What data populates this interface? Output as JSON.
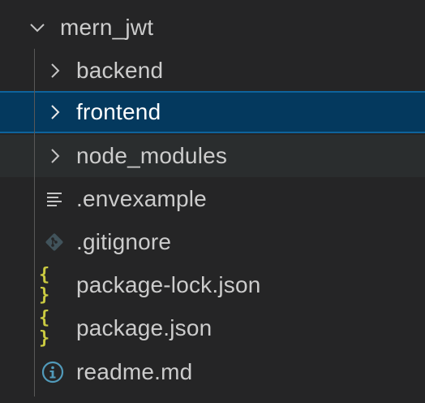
{
  "explorer": {
    "root": {
      "label": "mern_jwt",
      "icon": "chevron-down-icon"
    },
    "items": [
      {
        "label": "backend",
        "type": "folder",
        "icon": "chevron-right-icon"
      },
      {
        "label": "frontend",
        "type": "folder",
        "icon": "chevron-right-icon",
        "selected": true
      },
      {
        "label": "node_modules",
        "type": "folder",
        "icon": "chevron-right-icon",
        "hovered": true
      },
      {
        "label": ".envexample",
        "type": "file",
        "icon": "lines-file-icon"
      },
      {
        "label": ".gitignore",
        "type": "file",
        "icon": "git-icon"
      },
      {
        "label": "package-lock.json",
        "type": "file",
        "icon": "json-braces-icon"
      },
      {
        "label": "package.json",
        "type": "file",
        "icon": "json-braces-icon"
      },
      {
        "label": "readme.md",
        "type": "file",
        "icon": "info-icon"
      }
    ],
    "colors": {
      "background": "#252526",
      "selected_background": "#04395e",
      "selected_border": "#0e639c",
      "hover_background": "#2a2d2e",
      "text": "#cccccc",
      "json_icon": "#cbcb41",
      "info_icon": "#519aba",
      "git_icon": "#41535b"
    },
    "json_icon_glyph": "{ }"
  }
}
